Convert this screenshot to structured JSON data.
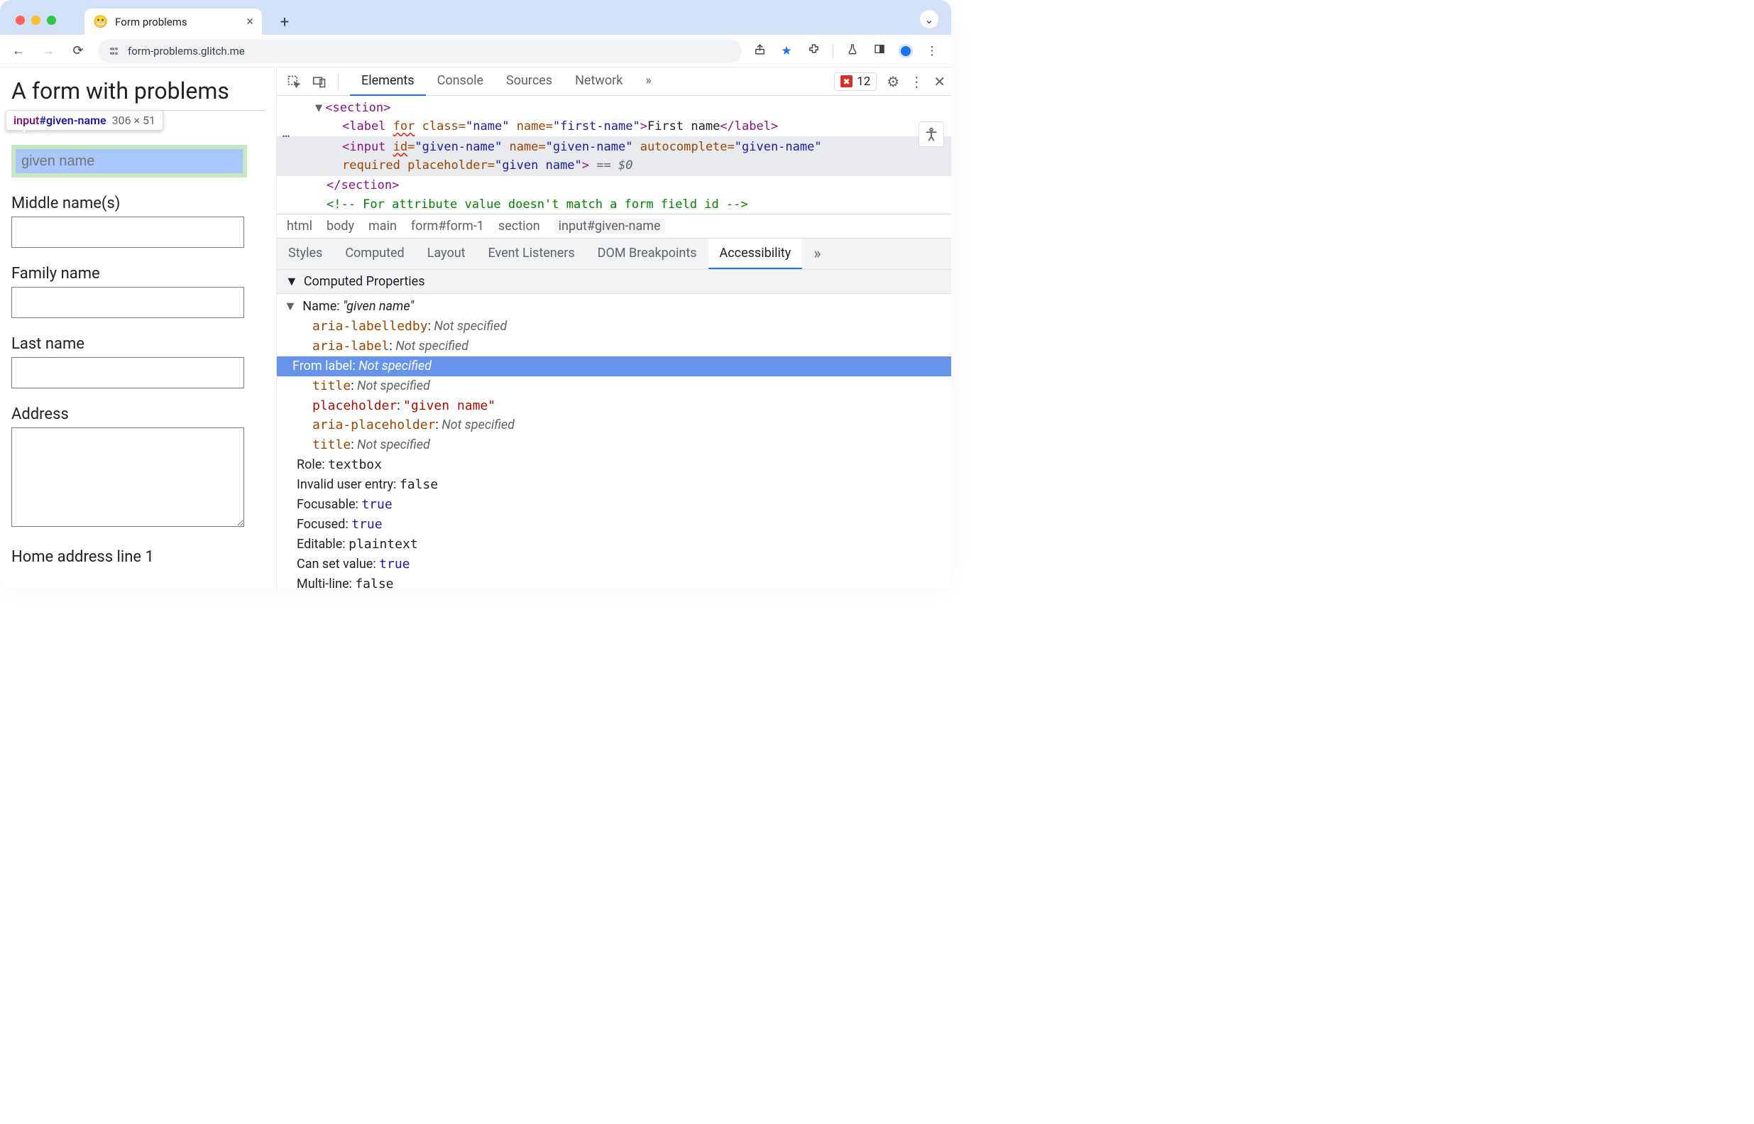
{
  "window": {
    "tab_title": "Form problems",
    "url": "form-problems.glitch.me",
    "favicon": "😬",
    "tabstrip_dropdown_glyph": "⌄",
    "newtab_glyph": "+"
  },
  "addr_icons": {
    "share": "⇪",
    "star": "★",
    "ext": "⛶",
    "flask": "⚗",
    "panel": "◧",
    "kebab": "⋮"
  },
  "page": {
    "h1": "A form with problems",
    "inspect_tooltip": {
      "tag": "input",
      "id": "#given-name",
      "dim": "306 × 51"
    },
    "given_name_placeholder": "given name",
    "labels": {
      "first": "First name",
      "middle": "Middle name(s)",
      "family": "Family name",
      "last": "Last name",
      "address": "Address",
      "home1": "Home address line 1"
    }
  },
  "devtools": {
    "tabs": [
      "Elements",
      "Console",
      "Sources",
      "Network"
    ],
    "more_glyph": "»",
    "errors": "12",
    "gear": "⚙",
    "kebab": "⋮",
    "close": "✕",
    "inspect_glyph": "⛶",
    "device_glyph": "⌐",
    "a11y_glyph": "⊼"
  },
  "dom": {
    "l1_open": "<section>",
    "l2_label_pre": "<label ",
    "l2_for": "for",
    "l2_class_attr": " class=",
    "l2_class_val": "\"name\"",
    "l2_name_attr": " name=",
    "l2_name_val": "\"first-name\"",
    "l2_gt": ">",
    "l2_text": "First name",
    "l2_close": "</label>",
    "l3_input_pre": "<input ",
    "l3_id": "id",
    "l3_eq": "=",
    "l3_id_val": "\"given-name\"",
    "l3_name_attr": " name=",
    "l3_name_val": "\"given-name\"",
    "l3_ac_attr": " autocomplete=",
    "l3_ac_val": "\"given-name\"",
    "l3b_required": "required",
    "l3b_ph_attr": " placeholder=",
    "l3b_ph_val": "\"given name\"",
    "l3b_gt": ">",
    "l3b_eq0": " == $0",
    "l4_close": "</section>",
    "l5_comment": "<!-- For attribute value doesn't match a form field id -->"
  },
  "breadcrumb": [
    "html",
    "body",
    "main",
    "form#form-1",
    "section",
    "input#given-name"
  ],
  "subtabs": [
    "Styles",
    "Computed",
    "Layout",
    "Event Listeners",
    "DOM Breakpoints",
    "Accessibility"
  ],
  "props": {
    "hdr": "Computed Properties",
    "name_label": "Name: ",
    "name_value": "\"given name\"",
    "rows": [
      {
        "k": "aria-labelledby",
        "v": "Not specified",
        "kcls": "p-orange pmono",
        "vcls": "p-grey-i"
      },
      {
        "k": "aria-label",
        "v": "Not specified",
        "kcls": "p-orange pmono",
        "vcls": "p-grey-i"
      },
      {
        "k": "From label",
        "v": "Not specified",
        "hl": true
      },
      {
        "k": "title",
        "v": "Not specified",
        "kcls": "p-orange pmono",
        "vcls": "p-grey-i"
      },
      {
        "k": "placeholder",
        "v": "\"given name\"",
        "kcls": "p-red pmono",
        "vcls": "p-red pmono"
      },
      {
        "k": "aria-placeholder",
        "v": "Not specified",
        "kcls": "p-orange pmono",
        "vcls": "p-grey-i"
      },
      {
        "k": "title",
        "v": "Not specified",
        "kcls": "p-orange pmono",
        "vcls": "p-grey-i"
      }
    ],
    "extras": [
      {
        "k": "Role",
        "v": "textbox",
        "vcls": "pmono"
      },
      {
        "k": "Invalid user entry",
        "v": "false",
        "vcls": "pmono"
      },
      {
        "k": "Focusable",
        "v": "true",
        "vcls": "pmono p-blue"
      },
      {
        "k": "Focused",
        "v": "true",
        "vcls": "pmono p-blue"
      },
      {
        "k": "Editable",
        "v": "plaintext",
        "vcls": "pmono"
      },
      {
        "k": "Can set value",
        "v": "true",
        "vcls": "pmono p-blue"
      },
      {
        "k": "Multi-line",
        "v": "false",
        "vcls": "pmono"
      }
    ]
  }
}
